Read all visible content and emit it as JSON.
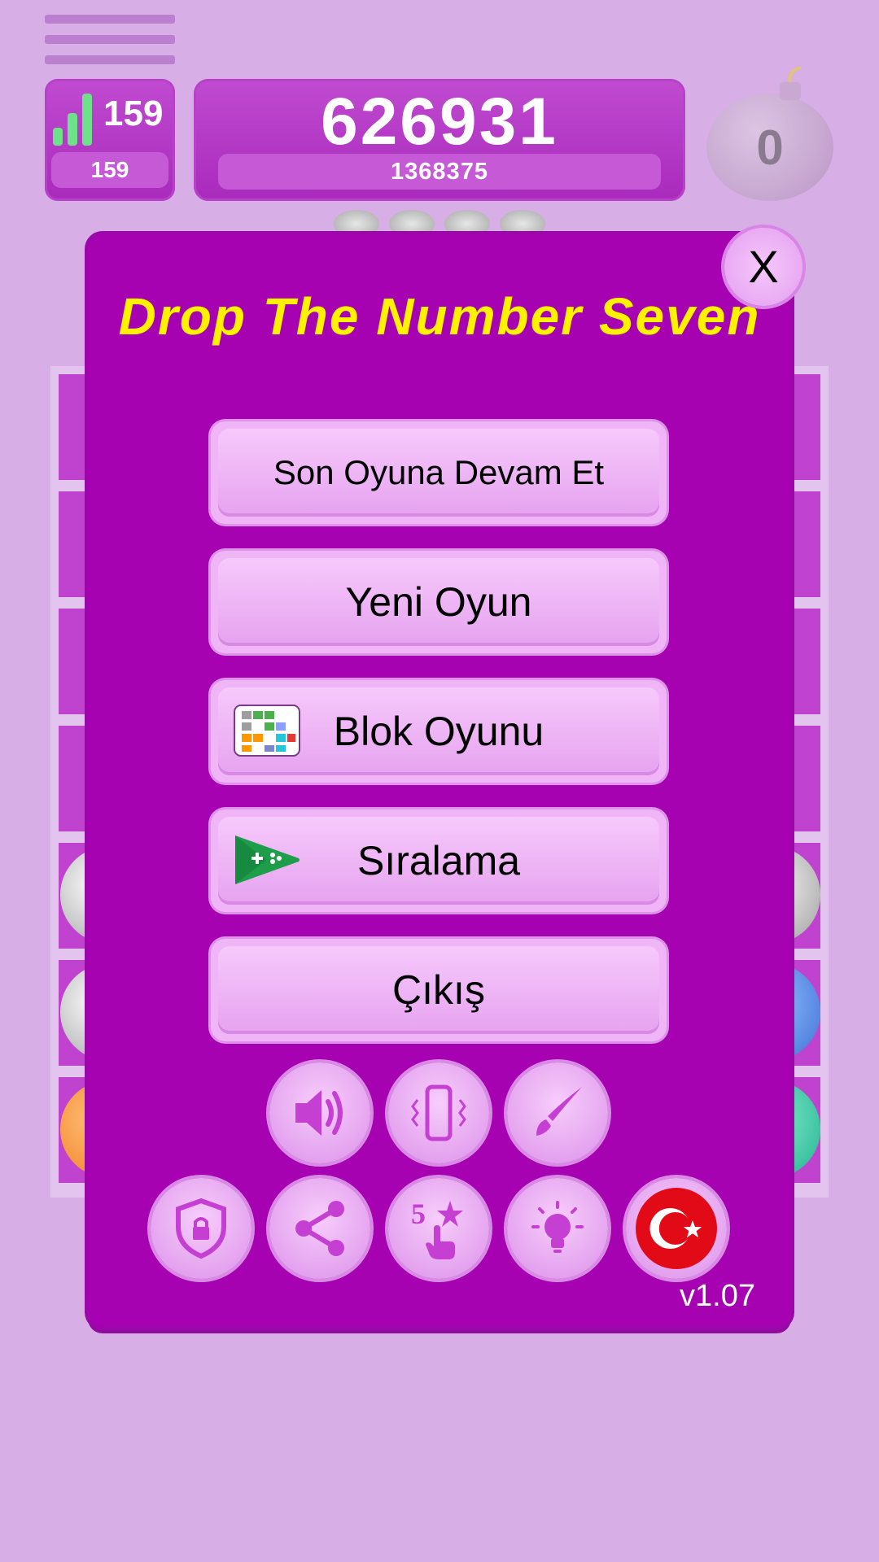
{
  "hud": {
    "level_value": "159",
    "level_sub": "159",
    "score": "626931",
    "best_score": "1368375",
    "bomb_count": "0"
  },
  "modal": {
    "title": "Drop The Number Seven",
    "close_label": "X",
    "buttons": [
      {
        "label": "Son Oyuna Devam Et"
      },
      {
        "label": "Yeni Oyun"
      },
      {
        "label": "Blok Oyunu",
        "icon": "block-game-icon"
      },
      {
        "label": "Sıralama",
        "icon": "play-games-icon"
      },
      {
        "label": "Çıkış"
      }
    ],
    "icon_row_1": [
      "sound-icon",
      "vibration-icon",
      "theme-brush-icon"
    ],
    "icon_row_2": [
      "privacy-shield-icon",
      "share-icon",
      "rate-5-stars-icon",
      "hint-bulb-icon",
      "turkish-flag-icon"
    ],
    "version": "v1.07"
  },
  "colors": {
    "background": "#d7aee6",
    "modal": "#a602b2",
    "title": "#fff200",
    "button": "#f0b5f6"
  }
}
